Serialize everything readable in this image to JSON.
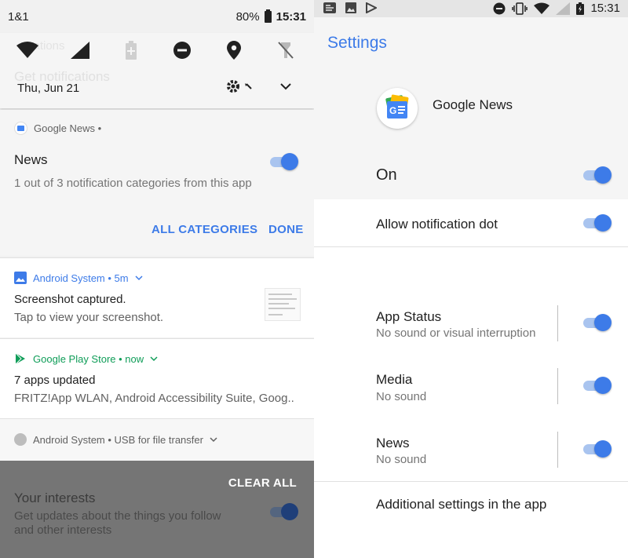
{
  "left": {
    "status": {
      "carrier": "1&1",
      "battery": "80%",
      "time": "15:31"
    },
    "quick_settings": {
      "ghost_line1": "cations",
      "ghost_line2": "Get notifications",
      "date": "Thu, Jun 21",
      "tiles": [
        "wifi-icon",
        "signal-icon",
        "battery-saver-icon",
        "dnd-icon",
        "location-icon",
        "flashlight-off-icon"
      ]
    },
    "google_news": {
      "app_line": "Google News •",
      "title": "News",
      "subtitle": "1 out of 3 notification categories from this app",
      "btn_all": "ALL CATEGORIES",
      "btn_done": "DONE",
      "toggle": 1
    },
    "screenshot_notif": {
      "app_line": "Android System • 5m",
      "title": "Screenshot captured.",
      "text": "Tap to view your screenshot."
    },
    "play_notif": {
      "app_line": "Google Play Store • now",
      "title": "7 apps updated",
      "text": "FRITZ!App WLAN, Android Accessibility Suite, Goog.."
    },
    "usb_notif": {
      "app_line": "Android System • USB for file transfer"
    },
    "dim_section": {
      "clear_all": "CLEAR ALL",
      "title": "Your interests",
      "subtitle": "Get updates about the things you follow and other interests",
      "toggle": 1
    }
  },
  "right": {
    "status": {
      "time": "15:31"
    },
    "title": "Settings",
    "app_name": "Google News",
    "on_label": "On",
    "allow_dot": "Allow notification dot",
    "categories": [
      {
        "title": "App Status",
        "subtitle": "No sound or visual interruption",
        "toggle": 1
      },
      {
        "title": "Media",
        "subtitle": "No sound",
        "toggle": 1
      },
      {
        "title": "News",
        "subtitle": "No sound",
        "toggle": 1
      }
    ],
    "additional": "Additional settings in the app",
    "colors": {
      "accent": "#3d7be8",
      "switch_track": "#a9c4ef",
      "page_bg": "#f5f5f5"
    }
  }
}
